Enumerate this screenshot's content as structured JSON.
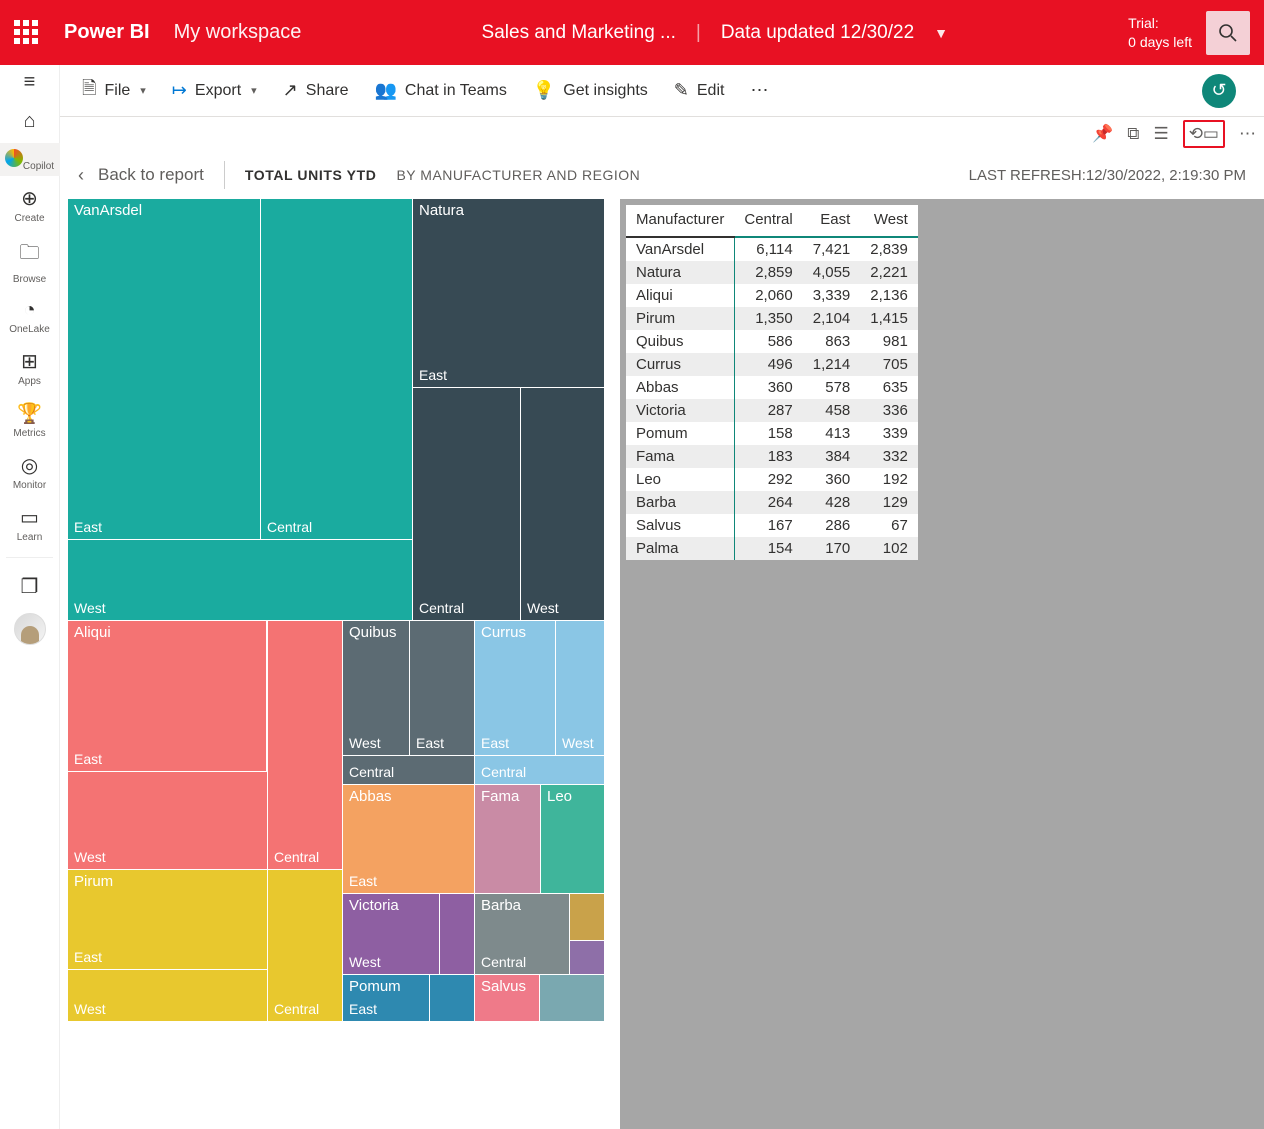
{
  "brand": "Power BI",
  "workspace": "My workspace",
  "report_title": "Sales and Marketing ...",
  "data_updated": "Data updated 12/30/22",
  "trial_label": "Trial:",
  "trial_days": "0 days left",
  "cmd": {
    "file": "File",
    "export": "Export",
    "share": "Share",
    "chat": "Chat in Teams",
    "insights": "Get insights",
    "edit": "Edit"
  },
  "nav": {
    "home": "",
    "copilot": "Copilot",
    "create": "Create",
    "browse": "Browse",
    "onelake": "OneLake",
    "apps": "Apps",
    "metrics": "Metrics",
    "monitor": "Monitor",
    "learn": "Learn"
  },
  "back_label": "Back to report",
  "title_main": "TOTAL UNITS YTD",
  "title_sub": "BY MANUFACTURER AND REGION",
  "last_refresh_label": "LAST REFRESH:",
  "last_refresh_value": "12/30/2022, 2:19:30 PM",
  "table_headers": [
    "Manufacturer",
    "Central",
    "East",
    "West"
  ],
  "chart_data": {
    "type": "table",
    "columns": [
      "Manufacturer",
      "Central",
      "East",
      "West"
    ],
    "rows": [
      {
        "mfr": "VanArsdel",
        "Central": 6114,
        "East": 7421,
        "West": 2839
      },
      {
        "mfr": "Natura",
        "Central": 2859,
        "East": 4055,
        "West": 2221
      },
      {
        "mfr": "Aliqui",
        "Central": 2060,
        "East": 3339,
        "West": 2136
      },
      {
        "mfr": "Pirum",
        "Central": 1350,
        "East": 2104,
        "West": 1415
      },
      {
        "mfr": "Quibus",
        "Central": 586,
        "East": 863,
        "West": 981
      },
      {
        "mfr": "Currus",
        "Central": 496,
        "East": 1214,
        "West": 705
      },
      {
        "mfr": "Abbas",
        "Central": 360,
        "East": 578,
        "West": 635
      },
      {
        "mfr": "Victoria",
        "Central": 287,
        "East": 458,
        "West": 336
      },
      {
        "mfr": "Pomum",
        "Central": 158,
        "East": 413,
        "West": 339
      },
      {
        "mfr": "Fama",
        "Central": 183,
        "East": 384,
        "West": 332
      },
      {
        "mfr": "Leo",
        "Central": 292,
        "East": 360,
        "West": 192
      },
      {
        "mfr": "Barba",
        "Central": 264,
        "East": 428,
        "West": 129
      },
      {
        "mfr": "Salvus",
        "Central": 167,
        "East": 286,
        "West": 67
      },
      {
        "mfr": "Palma",
        "Central": 154,
        "East": 170,
        "West": 102
      }
    ]
  },
  "treemap": {
    "mfr": {
      "vanarsdel": "VanArsdel",
      "natura": "Natura",
      "aliqui": "Aliqui",
      "pirum": "Pirum",
      "quibus": "Quibus",
      "currus": "Currus",
      "abbas": "Abbas",
      "victoria": "Victoria",
      "pomum": "Pomum",
      "fama": "Fama",
      "leo": "Leo",
      "barba": "Barba",
      "salvus": "Salvus"
    },
    "region": {
      "east": "East",
      "central": "Central",
      "west": "West"
    }
  },
  "colors": {
    "vanarsdel": "#1AAB9F",
    "natura": "#374A54",
    "aliqui": "#F47373",
    "pirum": "#E8C82E",
    "quibus": "#5C6B73",
    "currus": "#8AC6E5",
    "abbas": "#F4A261",
    "victoria": "#8E5FA2",
    "pomum": "#2E89B0",
    "fama": "#C98BA5",
    "leo": "#3FB59B",
    "barba": "#7E8A8C",
    "salvus": "#EF7A89"
  }
}
